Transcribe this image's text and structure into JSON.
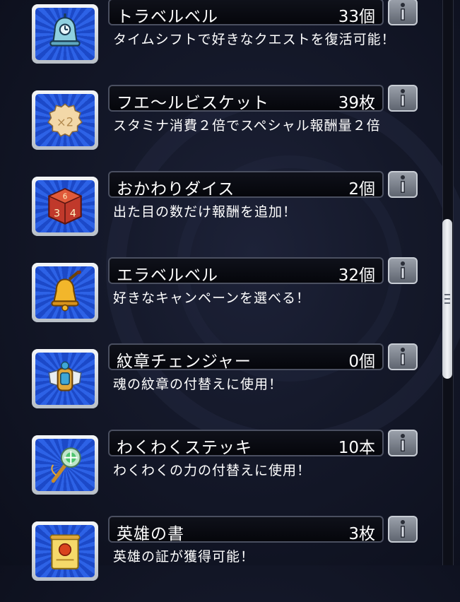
{
  "items": [
    {
      "name": "トラベルベル",
      "count": "33個",
      "desc": "タイムシフトで好きなクエストを復活可能！",
      "icon": "travel-bell-icon"
    },
    {
      "name": "フエ～ルビスケット",
      "count": "39枚",
      "desc": "スタミナ消費２倍でスペシャル報酬量２倍",
      "icon": "biscuit-icon"
    },
    {
      "name": "おかわりダイス",
      "count": "2個",
      "desc": "出た目の数だけ報酬を追加！",
      "icon": "dice-icon"
    },
    {
      "name": "エラベルベル",
      "count": "32個",
      "desc": "好きなキャンペーンを選べる！",
      "icon": "erabel-bell-icon"
    },
    {
      "name": "紋章チェンジャー",
      "count": "0個",
      "desc": "魂の紋章の付替えに使用！",
      "icon": "emblem-changer-icon"
    },
    {
      "name": "わくわくステッキ",
      "count": "10本",
      "desc": "わくわくの力の付替えに使用！",
      "icon": "wakuwaku-stick-icon"
    },
    {
      "name": "英雄の書",
      "count": "3枚",
      "desc": "英雄の証が獲得可能！",
      "icon": "hero-book-icon"
    }
  ],
  "info_button_icon": "info-icon",
  "colors": {
    "icon_bg": "#2d62e6",
    "bar_bg": "#05060b",
    "text": "#ffffff"
  }
}
